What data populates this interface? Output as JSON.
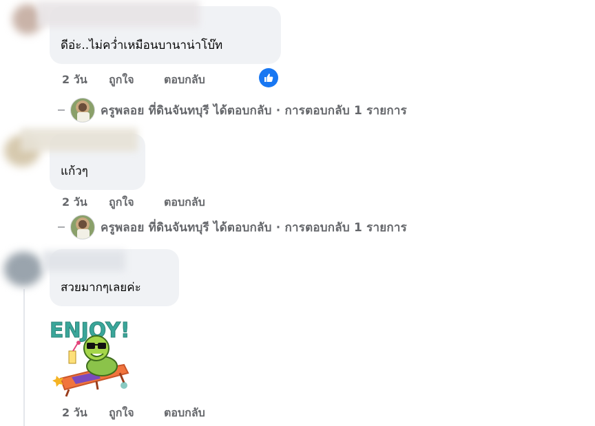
{
  "comments": [
    {
      "text": "ดีอ่ะ..ไม่คว่ำเหมือนบานาน่าโบ๊ท",
      "actions": {
        "time": "2 วัน",
        "like": "ถูกใจ",
        "reply": "ตอบกลับ"
      },
      "reaction_icon": "thumbs-up-icon",
      "reply_summary": "ครูพลอย ที่ดินจันทบุรี ได้ตอบกลับ · การตอบกลับ 1 รายการ"
    },
    {
      "text": "แก้วๆ",
      "actions": {
        "time": "2 วัน",
        "like": "ถูกใจ",
        "reply": "ตอบกลับ"
      },
      "reply_summary": "ครูพลอย ที่ดินจันทบุรี ได้ตอบกลับ · การตอบกลับ 1 รายการ"
    },
    {
      "text": "สวยมากๆเลยค่ะ",
      "sticker": {
        "text": "ENJOY!",
        "icon": "turtle-sunbathing-sticker"
      },
      "actions": {
        "time": "2 วัน",
        "like": "ถูกใจ",
        "reply": "ตอบกลับ"
      }
    }
  ],
  "colors": {
    "bubble": "#f0f2f5",
    "meta_text": "#65676b",
    "like_blue": "#1877f2",
    "sticker_teal": "#3aa69a"
  }
}
